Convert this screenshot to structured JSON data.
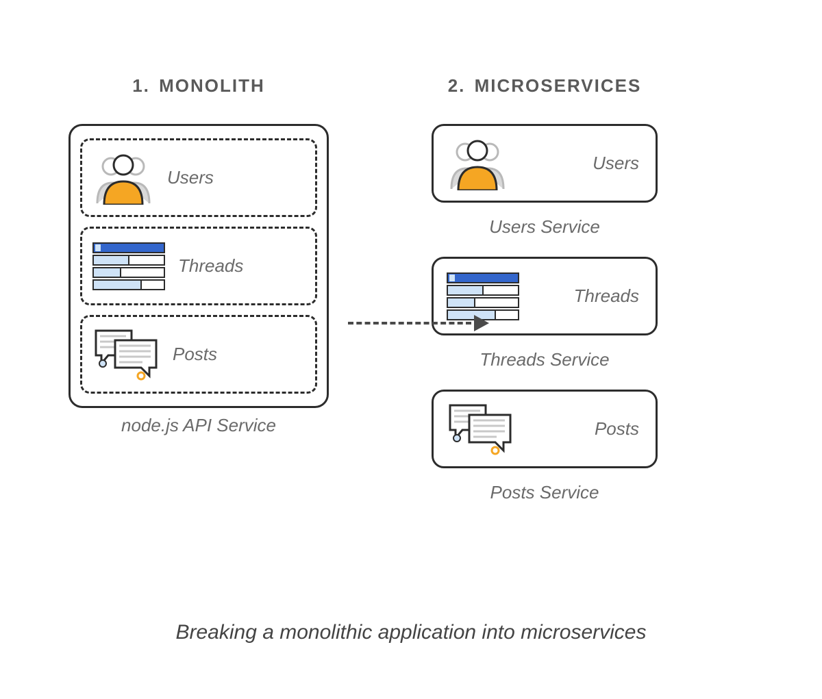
{
  "col1": {
    "heading_num": "1.",
    "heading_text": "MONOLITH",
    "caption": "node.js API Service"
  },
  "col2": {
    "heading_num": "2.",
    "heading_text": "MICROSERVICES"
  },
  "items": {
    "users": {
      "label": "Users",
      "svc": "Users Service"
    },
    "threads": {
      "label": "Threads",
      "svc": "Threads Service"
    },
    "posts": {
      "label": "Posts",
      "svc": "Posts Service"
    }
  },
  "figure_caption": "Breaking a monolithic application into microservices",
  "icon_colors": {
    "accent_orange": "#f5a623",
    "accent_blue": "#3366cc",
    "accent_lightblue": "#cfe3f7",
    "gray": "#b9b9b9",
    "stroke": "#2c2c2c"
  }
}
